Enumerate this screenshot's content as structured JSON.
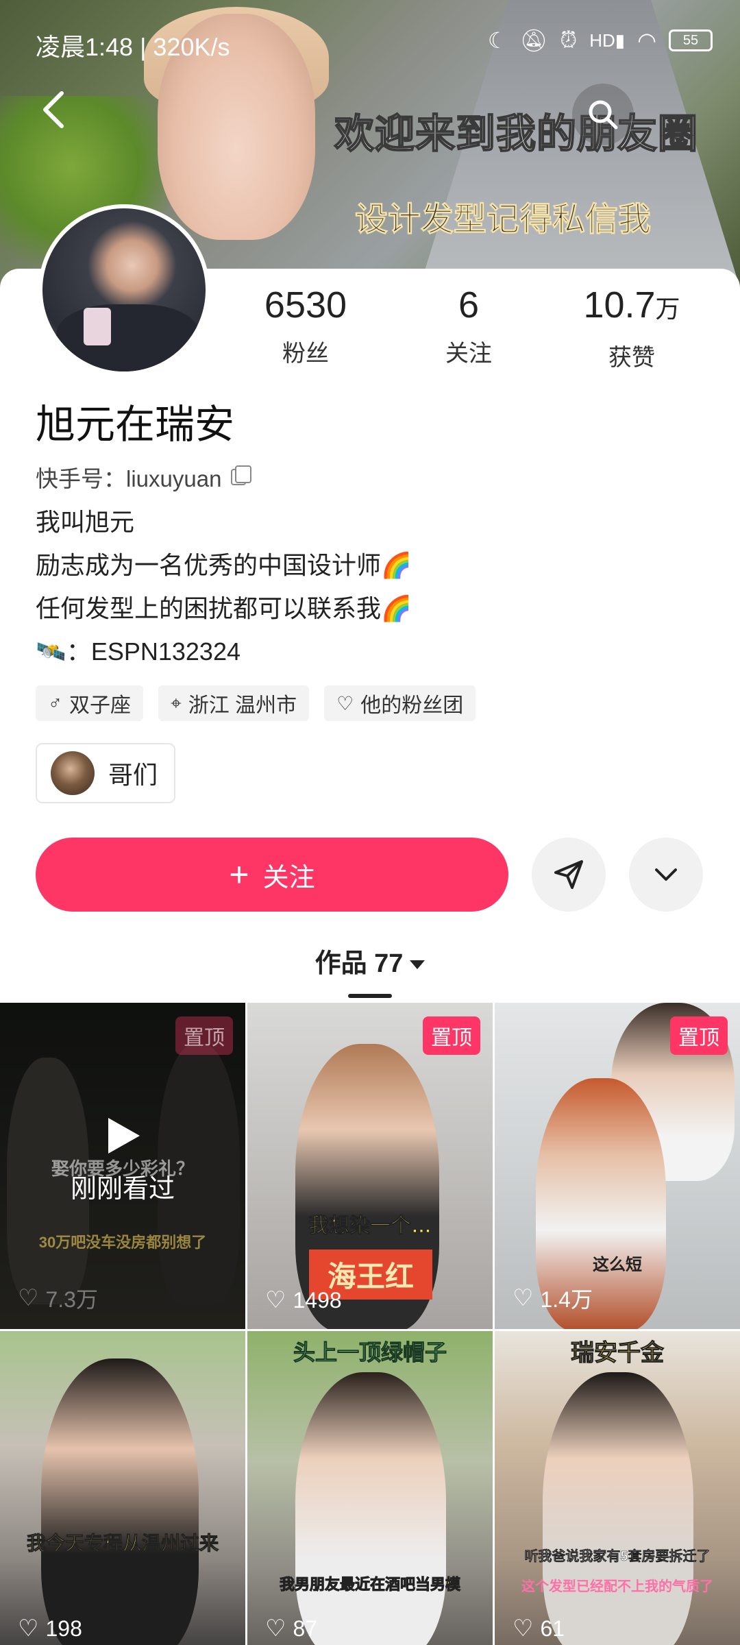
{
  "status_bar": {
    "time": "凌晨1:48 | 320K/s",
    "battery": "55",
    "icons": [
      "moon-icon",
      "mute-bell-icon",
      "alarm-icon",
      "hd-signal-icon",
      "wifi-icon",
      "battery-icon"
    ]
  },
  "cover": {
    "caption_line1": "欢迎来到我的朋友圈",
    "caption_line2": "设计发型记得私信我"
  },
  "stats": {
    "fans": {
      "value": "6530",
      "unit": "",
      "label": "粉丝"
    },
    "following": {
      "value": "6",
      "unit": "",
      "label": "关注"
    },
    "likes": {
      "value": "10.7",
      "unit": "万",
      "label": "获赞"
    }
  },
  "profile": {
    "name": "旭元在瑞安",
    "kuaishou_id": "快手号：liuxuyuan",
    "bio": [
      "我叫旭元",
      "励志成为一名优秀的中国设计师🌈",
      "任何发型上的困扰都可以联系我🌈",
      "🛰️：ESPN132324"
    ]
  },
  "tags": [
    {
      "icon": "male-icon",
      "glyph": "♂",
      "label": "双子座"
    },
    {
      "icon": "location-pin-icon",
      "glyph": "⌖",
      "label": "浙江 温州市"
    },
    {
      "icon": "heart-outline-icon",
      "glyph": "♡",
      "label": "他的粉丝团"
    }
  ],
  "group_chip": {
    "label": "哥们"
  },
  "actions": {
    "follow_label": "关注",
    "follow_plus": "+"
  },
  "works_tab": {
    "label": "作品 77"
  },
  "colors": {
    "accent": "#fe3666",
    "text": "#222222",
    "chip_bg": "#f3f3f3"
  },
  "videos": [
    {
      "pinned": "置顶",
      "likes": "7.3万",
      "caption_top": "娶你要多少彩礼？",
      "caption_bottom": "30万吧没车没房都别想了",
      "watched": "刚刚看过"
    },
    {
      "pinned": "置顶",
      "likes": "1498",
      "caption_top": "我想染一个…",
      "caption_bottom": "海王红"
    },
    {
      "pinned": "置顶",
      "likes": "1.4万",
      "caption_bottom": "这么短"
    },
    {
      "likes": "198",
      "caption_mid": "我今天专程从温州过来"
    },
    {
      "likes": "87",
      "caption_top": "头上一顶绿帽子",
      "caption_bottom": "我男朋友最近在酒吧当男模"
    },
    {
      "likes": "61",
      "caption_top": "瑞安千金",
      "caption_mid": "听我爸说我家有5套房要拆迁了",
      "caption_bottom": "这个发型已经配不上我的气质了"
    }
  ]
}
